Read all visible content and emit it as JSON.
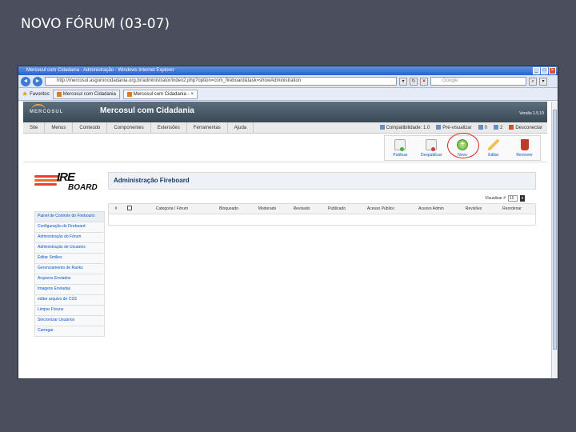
{
  "slide": {
    "title": "NOVO FÓRUM (03-07)"
  },
  "browser": {
    "window_title": "Mercosul com Cidadania - Administração - Windows Internet Explorer",
    "address": "http://mercosul.asguroncidadania.org.br/administrator/index2.php?option=com_fireboard&task=showAdministration",
    "search_placeholder": "Google",
    "favorites_label": "Favoritos",
    "tabs": [
      {
        "label": "Mercosul com Cidadania"
      },
      {
        "label": "Mercosul com Cidadania -"
      }
    ]
  },
  "site": {
    "logo_text": "MERCOSUL",
    "name": "Mercosul com Cidadania",
    "version": "Versão 1.5.10",
    "menu": [
      "Site",
      "Menus",
      "Conteúdo",
      "Componentes",
      "Extensões",
      "Ferramentas",
      "Ajuda"
    ],
    "status": {
      "compat": "Compatibilidade: 1.0",
      "preview": "Pré-visualizar",
      "messages": "0",
      "users": "2",
      "logout": "Desconectar"
    }
  },
  "toolbar": {
    "publish": "Publicar",
    "unpublish": "Despublicar",
    "new": "Novo",
    "edit": "Editar",
    "remove": "Remover"
  },
  "fireboard": {
    "logo_top": "IRE",
    "logo_bottom": "BOARD",
    "header": "Administração Fireboard",
    "display_label": "Visualizar #",
    "display_value": "10",
    "columns": [
      "#",
      "",
      "Categoria / Fórum",
      "Bloqueado",
      "Moderado",
      "Revisado",
      "Publicado",
      "Acesso Público",
      "Acesso Admin",
      "Revisões",
      "Reordenar"
    ],
    "sidebar": [
      "Painel de Controle do Fireboard",
      "Configuração do Fireboard",
      "Administração do Fórum",
      "Administração de Usuários",
      "Editar Smilies",
      "Gerenciamento de Ranks",
      "Arquivos Enviados",
      "Imagens Enviadas",
      "editar arquivo de CSS",
      "Limpar Fóruns",
      "Sincronizar Usuários",
      "Carregar"
    ]
  },
  "colors": {
    "slide_bg": "#4b4e5c",
    "banner": "#4a5a67",
    "link": "#0b55c4",
    "highlight": "#e02020"
  }
}
